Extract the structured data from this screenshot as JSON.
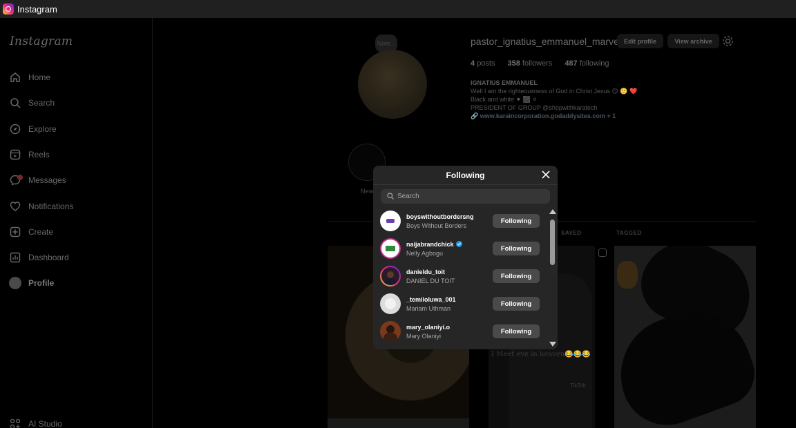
{
  "window": {
    "title": "Instagram"
  },
  "sidebar": {
    "logo": "Instagram",
    "items": [
      {
        "label": "Home",
        "icon": "home-icon"
      },
      {
        "label": "Search",
        "icon": "search-icon"
      },
      {
        "label": "Explore",
        "icon": "compass-icon"
      },
      {
        "label": "Reels",
        "icon": "reels-icon"
      },
      {
        "label": "Messages",
        "icon": "messenger-icon"
      },
      {
        "label": "Notifications",
        "icon": "heart-icon"
      },
      {
        "label": "Create",
        "icon": "plus-square-icon"
      },
      {
        "label": "Dashboard",
        "icon": "chart-icon"
      },
      {
        "label": "Profile",
        "icon": "avatar"
      },
      {
        "label": "AI Studio",
        "icon": "ai-studio-icon"
      }
    ]
  },
  "profile": {
    "note": "Note...",
    "username": "pastor_ignatius_emmanuel_marve",
    "edit_profile": "Edit profile",
    "view_archive": "View archive",
    "stats": {
      "posts_count": "4",
      "posts_label": "posts",
      "followers_count": "358",
      "followers_label": "followers",
      "following_count": "487",
      "following_label": "following"
    },
    "bio": {
      "name": "IGNATIUS EMMANUEL",
      "line1": "Well I am the righteousness of God in Christ Jesus 😊 🙂 ❤️",
      "line2": "Black and white ⚫ ⬛ ⚪",
      "line3": "PRESIDENT OF GROUP @shopwithkaratech",
      "link": "🔗 www.karaincorporation.godaddysites.com + 1"
    },
    "new_highlight": "New",
    "tabs": {
      "saved": "SAVED",
      "tagged": "TAGGED"
    },
    "post_caption": "I Meet eve in heaven😂😂😂",
    "tiktok_watermark": "TikTok"
  },
  "modal": {
    "title": "Following",
    "search_placeholder": "Search",
    "users": [
      {
        "username": "boyswithoutbordersng",
        "fullname": "Boys Without Borders",
        "button": "Following",
        "verified": false
      },
      {
        "username": "naijabrandchick",
        "fullname": "Nelly Agbogu",
        "button": "Following",
        "verified": true
      },
      {
        "username": "danieldu_toit",
        "fullname": "DANIEL DU TOIT",
        "button": "Following",
        "verified": false
      },
      {
        "username": "_temiloluwa_001",
        "fullname": "Mariam Uthman",
        "button": "Following",
        "verified": false
      },
      {
        "username": "mary_olaniyi.o",
        "fullname": "Mary Olaniyi",
        "button": "Following",
        "verified": false
      }
    ]
  },
  "colors": {
    "accent_verified": "#1d9bf0",
    "button_bg": "#4a4a4a",
    "modal_bg": "#262626"
  }
}
